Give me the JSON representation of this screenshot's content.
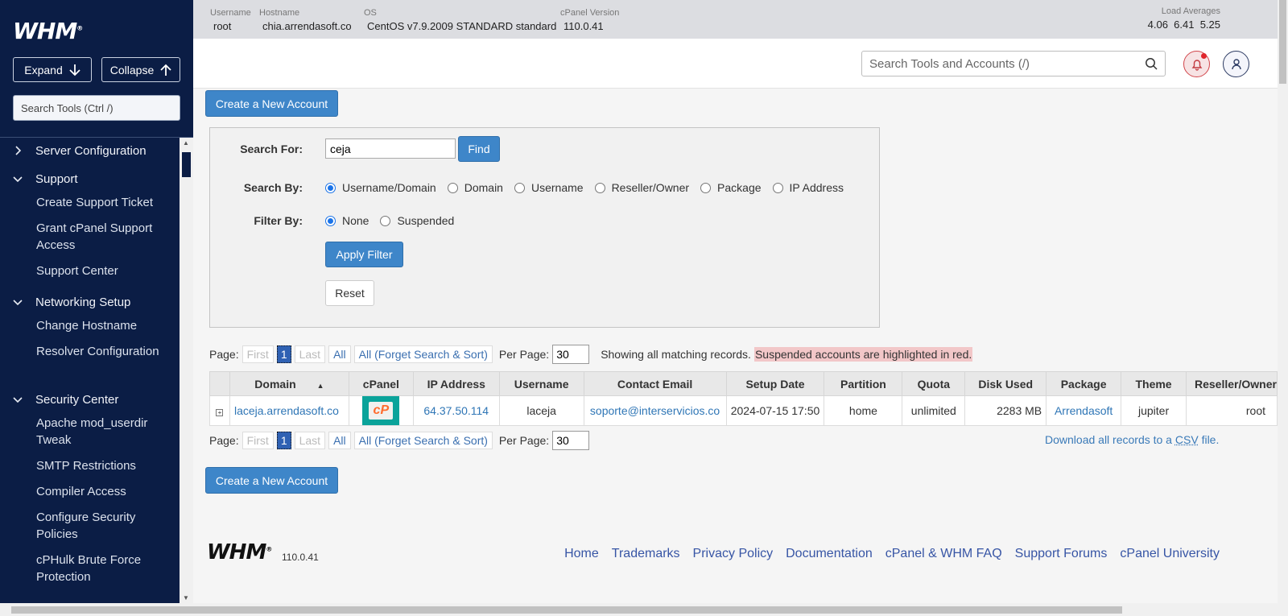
{
  "sidebar": {
    "logo": "WHM",
    "expand_label": "Expand",
    "collapse_label": "Collapse",
    "search_placeholder": "Search Tools (Ctrl /)",
    "sections": [
      {
        "label": "Server Configuration",
        "expanded": false,
        "items": []
      },
      {
        "label": "Support",
        "expanded": true,
        "items": [
          "Create Support Ticket",
          "Grant cPanel Support Access",
          "Support Center"
        ]
      },
      {
        "label": "Networking Setup",
        "expanded": true,
        "items": [
          "Change Hostname",
          "Resolver Configuration"
        ]
      },
      {
        "label": "Security Center",
        "expanded": true,
        "items": [
          "Apache mod_userdir Tweak",
          "SMTP Restrictions",
          "Compiler Access",
          "Configure Security Policies",
          "cPHulk Brute Force Protection"
        ]
      }
    ]
  },
  "header": {
    "username_label": "Username",
    "username": "root",
    "hostname_label": "Hostname",
    "hostname": "chia.arrendasoft.co",
    "os_label": "OS",
    "os": "CentOS v7.9.2009 STANDARD standard",
    "version_label": "cPanel Version",
    "version": "110.0.41",
    "load_label": "Load Averages",
    "load": "4.06  6.41  5.25",
    "search_placeholder": "Search Tools and Accounts (/)"
  },
  "main": {
    "create_account_label": "Create a New Account",
    "search_for_label": "Search For:",
    "search_value": "ceja",
    "find_label": "Find",
    "search_by_label": "Search By:",
    "search_by_options": [
      "Username/Domain",
      "Domain",
      "Username",
      "Reseller/Owner",
      "Package",
      "IP Address"
    ],
    "search_by_selected": "Username/Domain",
    "filter_by_label": "Filter By:",
    "filter_by_options": [
      "None",
      "Suspended"
    ],
    "filter_by_selected": "None",
    "apply_filter_label": "Apply Filter",
    "reset_label": "Reset",
    "pager": {
      "page_label": "Page:",
      "first": "First",
      "current": "1",
      "last": "Last",
      "all": "All",
      "all_forget": "All (Forget Search & Sort)",
      "per_page_label": "Per Page:",
      "per_page": "30"
    },
    "showing_text": "Showing all matching records.",
    "suspended_note": "Suspended accounts are highlighted in red.",
    "download_prefix": "Download all records to a",
    "download_csv": "CSV",
    "download_suffix": "file.",
    "table": {
      "columns": [
        "Domain",
        "cPanel",
        "IP Address",
        "Username",
        "Contact Email",
        "Setup Date",
        "Partition",
        "Quota",
        "Disk Used",
        "Package",
        "Theme",
        "Reseller/Owner"
      ],
      "sort_indicator": "▲",
      "rows": [
        {
          "domain": "laceja.arrendasoft.co",
          "cpanel": "cP",
          "ip": "64.37.50.114",
          "username": "laceja",
          "email": "soporte@interservicios.co",
          "setup_date": "2024-07-15 17:50",
          "partition": "home",
          "quota": "unlimited",
          "disk_used": "2283 MB",
          "package": "Arrendasoft",
          "theme": "jupiter",
          "owner": "root"
        }
      ]
    }
  },
  "footer": {
    "logo": "WHM",
    "version": "110.0.41",
    "links": [
      "Home",
      "Trademarks",
      "Privacy Policy",
      "Documentation",
      "cPanel & WHM FAQ",
      "Support Forums",
      "cPanel University"
    ]
  },
  "colors": {
    "sidebar_bg": "#0b1d45",
    "primary_button": "#3e86c9",
    "link": "#2f76b6",
    "suspended_highlight": "#f2c7c8",
    "cpanel_tile": "#0aa39a"
  }
}
